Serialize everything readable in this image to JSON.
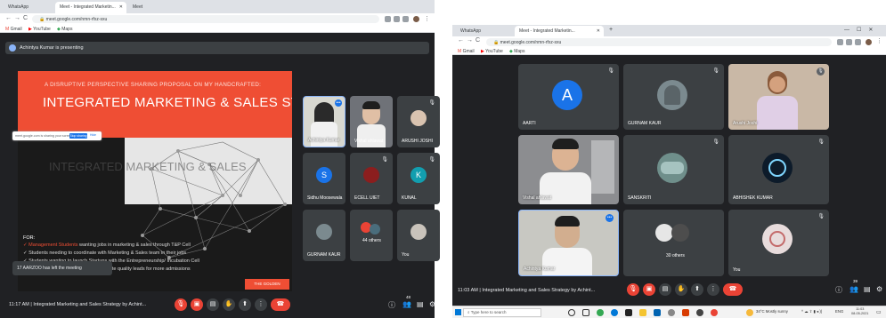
{
  "left": {
    "tabs": [
      {
        "label": "WhatsApp"
      },
      {
        "label": "Meet - Integrated Marketin..."
      },
      {
        "label": "Meet"
      }
    ],
    "url": "meet.google.com/nmn-rfxz-sxu",
    "bookmarks": [
      "Gmail",
      "YouTube",
      "Maps"
    ],
    "presenting": "Achintya Kumar is presenting",
    "slide": {
      "kicker": "A DISRUPTIVE PERSPECTIVE SHARING PROPOSAL ON MY HANDCRAFTED:",
      "title": "INTEGRATED MARKETING & SALES STRATEGY",
      "ghost": "INTEGRATED MARKETING & SALES",
      "for": "FOR:",
      "line1_hl": "✓ Management Students",
      "line1_rest": " wanting jobs in marketing & sales through T&P Cell",
      "line2": "✓ Students needing to coordinate with Marketing & Sales team in their jobs",
      "line3": "✓ Students wanting to launch Startups with the Entrepreneurship/ Incubation Cell",
      "line4": "✓ The College Marketing team to generate quality leads for more admissions",
      "logo": "THE GOLDEN UNIVERSE"
    },
    "share_bar": {
      "text": "meet.google.com is sharing your screen.",
      "stop": "Stop sharing",
      "hide": "Hide"
    },
    "toast": "17 AARZOO has left the meeting",
    "tiles": [
      {
        "name": "Achintya Kumar"
      },
      {
        "name": "Vishal ahlawat"
      },
      {
        "name": "ARUSHI JOSHI"
      },
      {
        "name": "Sidhu Moosewala",
        "initial": "S"
      },
      {
        "name": "ECELL UIET"
      },
      {
        "name": "KUNAL",
        "initial": "K"
      },
      {
        "name": "GURNAM KAUR"
      },
      {
        "name": "44 others"
      },
      {
        "name": "You"
      }
    ],
    "time": "11:17 AM",
    "meeting_title": "Integrated Marketing and Sales Strategy by Achint...",
    "participant_count": "48"
  },
  "right": {
    "tabs": [
      {
        "label": "WhatsApp"
      },
      {
        "label": "Meet - Integrated Marketin..."
      }
    ],
    "url": "meet.google.com/nmn-rfxz-sxu",
    "bookmarks": [
      "Gmail",
      "YouTube",
      "Maps"
    ],
    "tiles": [
      {
        "name": "AARTI",
        "initial": "A"
      },
      {
        "name": "GURNAM KAUR"
      },
      {
        "name": "Arushi Joshi"
      },
      {
        "name": "Vishal ahlawat"
      },
      {
        "name": "SANSKRITI"
      },
      {
        "name": "ABHISHEK KUMAR"
      },
      {
        "name": "Achintya Kumar"
      },
      {
        "name": "30 others"
      },
      {
        "name": "You"
      }
    ],
    "time": "11:03 AM",
    "meeting_title": "Integrated Marketing and Sales Strategy by Achint...",
    "participant_count": "39",
    "taskbar": {
      "search": "Type here to search",
      "weather": "34°C Mostly sunny",
      "clock_time": "11:03",
      "clock_date": "08-05-2021",
      "lang": "ENG"
    }
  },
  "colors": {
    "meet_bg": "#202124",
    "tile_bg": "#3c4043",
    "end_call": "#ea4335",
    "slide_accent": "#ef4e34",
    "sidhu": "#1a73e8",
    "kunal": "#129eaf",
    "aarti": "#1a73e8"
  }
}
